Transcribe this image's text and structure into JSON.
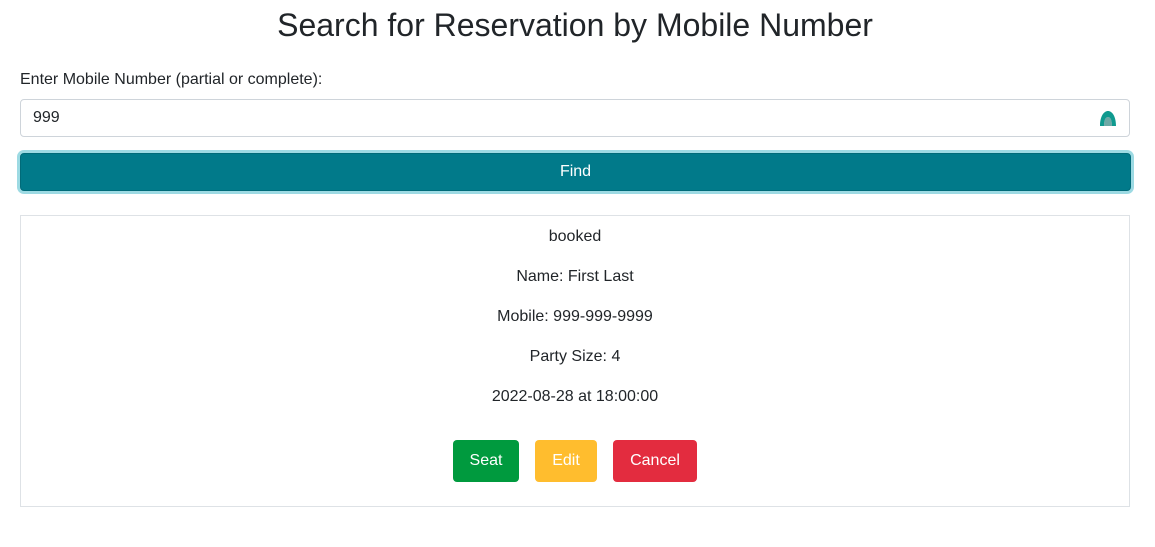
{
  "header": {
    "title": "Search for Reservation by Mobile Number"
  },
  "search": {
    "label": "Enter Mobile Number (partial or complete):",
    "value": "999",
    "placeholder": "",
    "find_label": "Find"
  },
  "result": {
    "status": "booked",
    "name": "Name: First Last",
    "mobile": "Mobile: 999-999-9999",
    "party_size": "Party Size: 4",
    "datetime": "2022-08-28 at 18:00:00",
    "actions": {
      "seat_label": "Seat",
      "edit_label": "Edit",
      "cancel_label": "Cancel"
    }
  },
  "colors": {
    "primary": "#017a8a",
    "seat": "#009a3e",
    "edit": "#ffbd2e",
    "cancel": "#e32c3f",
    "extension_icon": "#0f9a8f"
  },
  "icons": {
    "input_extension": "extension-icon"
  }
}
